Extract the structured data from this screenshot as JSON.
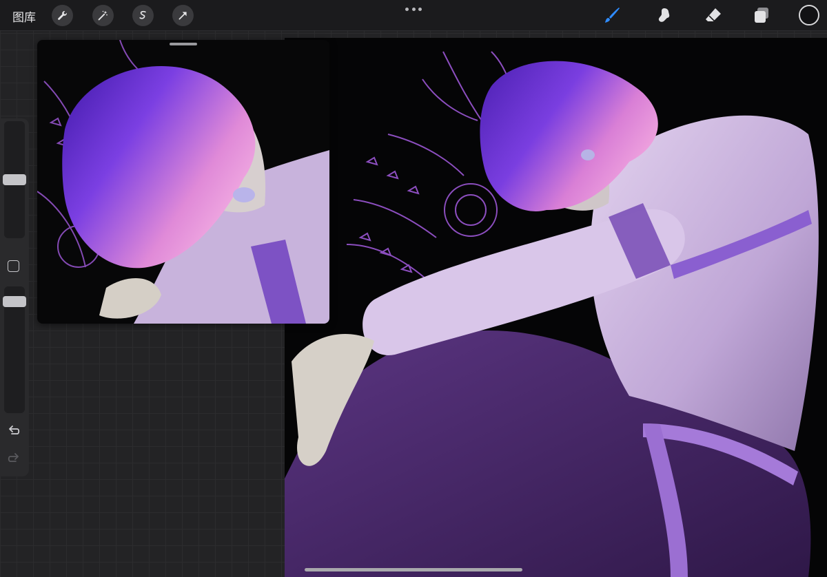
{
  "toolbar": {
    "gallery_label": "图库",
    "left_tools": [
      "wrench-icon",
      "magic-wand-icon",
      "selection-icon",
      "transform-arrow-icon"
    ],
    "right_tools": [
      "brush-icon",
      "smudge-icon",
      "eraser-icon",
      "layers-icon",
      "color-swatch"
    ],
    "active_tool": "brush-icon"
  },
  "colors": {
    "accent": "#2f8cff",
    "current_color": "#121214",
    "hair_purple": "#6a2bd6",
    "hair_pink": "#e08ad8",
    "shirt_lavender": "#c9b3dc",
    "pants_purple": "#4b2a68",
    "belt_violet": "#a57ad9",
    "canvas_bg": "#050506"
  },
  "sidebar": {
    "brush_size_level": 0.55,
    "opacity_level": 1.0,
    "items": [
      "brush-size-slider",
      "modify-button",
      "opacity-slider",
      "undo-button",
      "redo-button"
    ]
  },
  "reference_window": {
    "visible": true
  }
}
